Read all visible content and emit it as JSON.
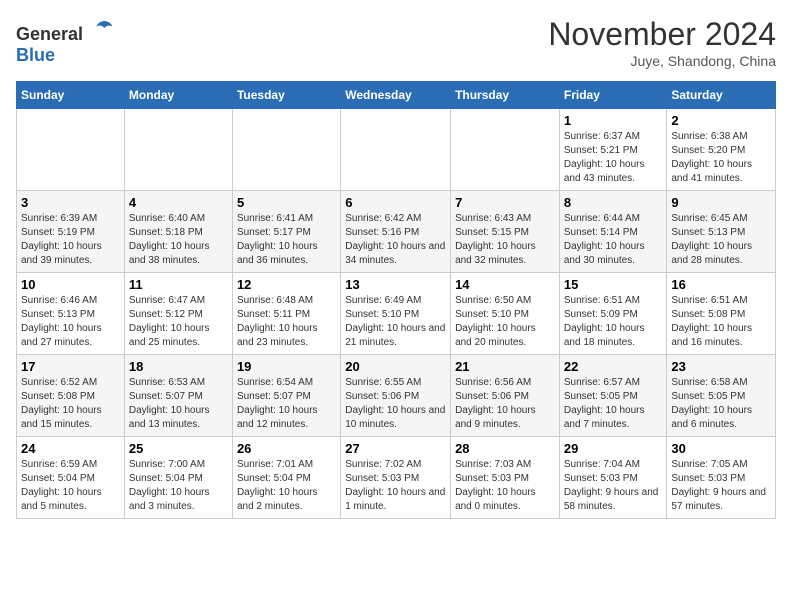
{
  "logo": {
    "general": "General",
    "blue": "Blue"
  },
  "header": {
    "month": "November 2024",
    "location": "Juye, Shandong, China"
  },
  "weekdays": [
    "Sunday",
    "Monday",
    "Tuesday",
    "Wednesday",
    "Thursday",
    "Friday",
    "Saturday"
  ],
  "weeks": [
    [
      {
        "day": "",
        "sunrise": "",
        "sunset": "",
        "daylight": ""
      },
      {
        "day": "",
        "sunrise": "",
        "sunset": "",
        "daylight": ""
      },
      {
        "day": "",
        "sunrise": "",
        "sunset": "",
        "daylight": ""
      },
      {
        "day": "",
        "sunrise": "",
        "sunset": "",
        "daylight": ""
      },
      {
        "day": "",
        "sunrise": "",
        "sunset": "",
        "daylight": ""
      },
      {
        "day": "1",
        "sunrise": "Sunrise: 6:37 AM",
        "sunset": "Sunset: 5:21 PM",
        "daylight": "Daylight: 10 hours and 43 minutes."
      },
      {
        "day": "2",
        "sunrise": "Sunrise: 6:38 AM",
        "sunset": "Sunset: 5:20 PM",
        "daylight": "Daylight: 10 hours and 41 minutes."
      }
    ],
    [
      {
        "day": "3",
        "sunrise": "Sunrise: 6:39 AM",
        "sunset": "Sunset: 5:19 PM",
        "daylight": "Daylight: 10 hours and 39 minutes."
      },
      {
        "day": "4",
        "sunrise": "Sunrise: 6:40 AM",
        "sunset": "Sunset: 5:18 PM",
        "daylight": "Daylight: 10 hours and 38 minutes."
      },
      {
        "day": "5",
        "sunrise": "Sunrise: 6:41 AM",
        "sunset": "Sunset: 5:17 PM",
        "daylight": "Daylight: 10 hours and 36 minutes."
      },
      {
        "day": "6",
        "sunrise": "Sunrise: 6:42 AM",
        "sunset": "Sunset: 5:16 PM",
        "daylight": "Daylight: 10 hours and 34 minutes."
      },
      {
        "day": "7",
        "sunrise": "Sunrise: 6:43 AM",
        "sunset": "Sunset: 5:15 PM",
        "daylight": "Daylight: 10 hours and 32 minutes."
      },
      {
        "day": "8",
        "sunrise": "Sunrise: 6:44 AM",
        "sunset": "Sunset: 5:14 PM",
        "daylight": "Daylight: 10 hours and 30 minutes."
      },
      {
        "day": "9",
        "sunrise": "Sunrise: 6:45 AM",
        "sunset": "Sunset: 5:13 PM",
        "daylight": "Daylight: 10 hours and 28 minutes."
      }
    ],
    [
      {
        "day": "10",
        "sunrise": "Sunrise: 6:46 AM",
        "sunset": "Sunset: 5:13 PM",
        "daylight": "Daylight: 10 hours and 27 minutes."
      },
      {
        "day": "11",
        "sunrise": "Sunrise: 6:47 AM",
        "sunset": "Sunset: 5:12 PM",
        "daylight": "Daylight: 10 hours and 25 minutes."
      },
      {
        "day": "12",
        "sunrise": "Sunrise: 6:48 AM",
        "sunset": "Sunset: 5:11 PM",
        "daylight": "Daylight: 10 hours and 23 minutes."
      },
      {
        "day": "13",
        "sunrise": "Sunrise: 6:49 AM",
        "sunset": "Sunset: 5:10 PM",
        "daylight": "Daylight: 10 hours and 21 minutes."
      },
      {
        "day": "14",
        "sunrise": "Sunrise: 6:50 AM",
        "sunset": "Sunset: 5:10 PM",
        "daylight": "Daylight: 10 hours and 20 minutes."
      },
      {
        "day": "15",
        "sunrise": "Sunrise: 6:51 AM",
        "sunset": "Sunset: 5:09 PM",
        "daylight": "Daylight: 10 hours and 18 minutes."
      },
      {
        "day": "16",
        "sunrise": "Sunrise: 6:51 AM",
        "sunset": "Sunset: 5:08 PM",
        "daylight": "Daylight: 10 hours and 16 minutes."
      }
    ],
    [
      {
        "day": "17",
        "sunrise": "Sunrise: 6:52 AM",
        "sunset": "Sunset: 5:08 PM",
        "daylight": "Daylight: 10 hours and 15 minutes."
      },
      {
        "day": "18",
        "sunrise": "Sunrise: 6:53 AM",
        "sunset": "Sunset: 5:07 PM",
        "daylight": "Daylight: 10 hours and 13 minutes."
      },
      {
        "day": "19",
        "sunrise": "Sunrise: 6:54 AM",
        "sunset": "Sunset: 5:07 PM",
        "daylight": "Daylight: 10 hours and 12 minutes."
      },
      {
        "day": "20",
        "sunrise": "Sunrise: 6:55 AM",
        "sunset": "Sunset: 5:06 PM",
        "daylight": "Daylight: 10 hours and 10 minutes."
      },
      {
        "day": "21",
        "sunrise": "Sunrise: 6:56 AM",
        "sunset": "Sunset: 5:06 PM",
        "daylight": "Daylight: 10 hours and 9 minutes."
      },
      {
        "day": "22",
        "sunrise": "Sunrise: 6:57 AM",
        "sunset": "Sunset: 5:05 PM",
        "daylight": "Daylight: 10 hours and 7 minutes."
      },
      {
        "day": "23",
        "sunrise": "Sunrise: 6:58 AM",
        "sunset": "Sunset: 5:05 PM",
        "daylight": "Daylight: 10 hours and 6 minutes."
      }
    ],
    [
      {
        "day": "24",
        "sunrise": "Sunrise: 6:59 AM",
        "sunset": "Sunset: 5:04 PM",
        "daylight": "Daylight: 10 hours and 5 minutes."
      },
      {
        "day": "25",
        "sunrise": "Sunrise: 7:00 AM",
        "sunset": "Sunset: 5:04 PM",
        "daylight": "Daylight: 10 hours and 3 minutes."
      },
      {
        "day": "26",
        "sunrise": "Sunrise: 7:01 AM",
        "sunset": "Sunset: 5:04 PM",
        "daylight": "Daylight: 10 hours and 2 minutes."
      },
      {
        "day": "27",
        "sunrise": "Sunrise: 7:02 AM",
        "sunset": "Sunset: 5:03 PM",
        "daylight": "Daylight: 10 hours and 1 minute."
      },
      {
        "day": "28",
        "sunrise": "Sunrise: 7:03 AM",
        "sunset": "Sunset: 5:03 PM",
        "daylight": "Daylight: 10 hours and 0 minutes."
      },
      {
        "day": "29",
        "sunrise": "Sunrise: 7:04 AM",
        "sunset": "Sunset: 5:03 PM",
        "daylight": "Daylight: 9 hours and 58 minutes."
      },
      {
        "day": "30",
        "sunrise": "Sunrise: 7:05 AM",
        "sunset": "Sunset: 5:03 PM",
        "daylight": "Daylight: 9 hours and 57 minutes."
      }
    ]
  ]
}
